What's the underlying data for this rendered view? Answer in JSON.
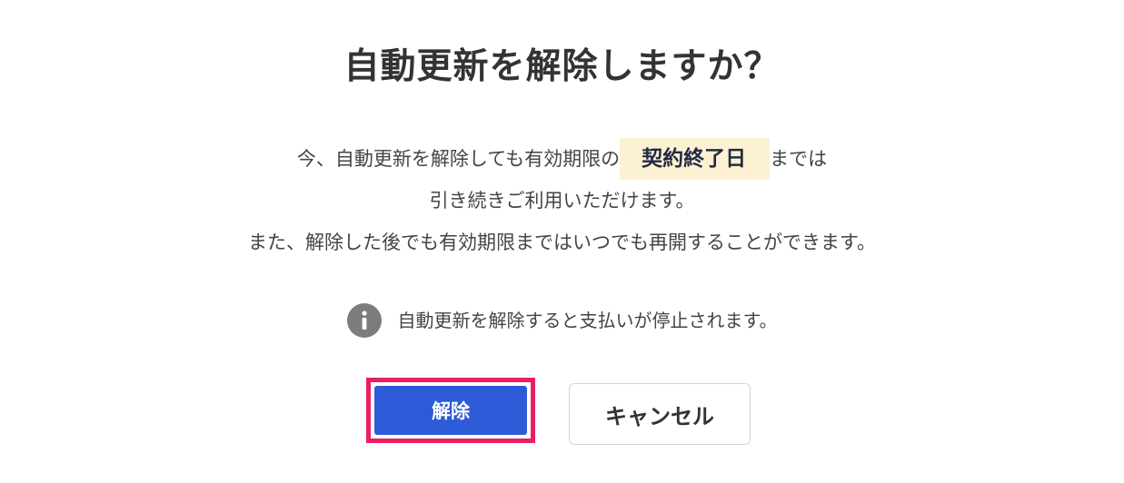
{
  "dialog": {
    "title": "自動更新を解除しますか？",
    "body": {
      "line1_prefix": "今、自動更新を解除しても有効期限の",
      "line1_highlight": "契約終了日",
      "line1_suffix": "までは",
      "line2": "引き続きご利用いただけます。",
      "line3": "また、解除した後でも有効期限まではいつでも再開することができます。"
    },
    "notice": {
      "icon": "info-icon",
      "text": "自動更新を解除すると支払いが停止されます。"
    },
    "buttons": {
      "confirm_label": "解除",
      "cancel_label": "キャンセル"
    },
    "colors": {
      "primary": "#2d5bd7",
      "highlight_frame": "#e91e63",
      "highlight_bg": "#fcf1d2",
      "info_icon": "#7c7c7c"
    }
  }
}
